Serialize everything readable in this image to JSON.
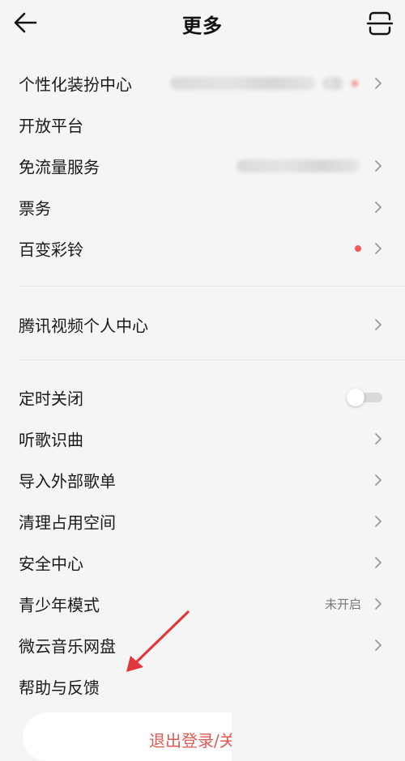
{
  "header": {
    "title": "更多",
    "back_icon": "arrow-left-icon",
    "scan_icon": "scan-icon"
  },
  "section1": [
    {
      "label": "个性化装扮中心"
    },
    {
      "label": "开放平台"
    },
    {
      "label": "免流量服务"
    },
    {
      "label": "票务"
    },
    {
      "label": "百变彩铃"
    }
  ],
  "section2": [
    {
      "label": "腾讯视频个人中心"
    }
  ],
  "section3": [
    {
      "label": "定时关闭",
      "toggle_on": false
    },
    {
      "label": "听歌识曲"
    },
    {
      "label": "导入外部歌单"
    },
    {
      "label": "清理占用空间"
    },
    {
      "label": "安全中心"
    },
    {
      "label": "青少年模式",
      "status": "未开启"
    },
    {
      "label": "微云音乐网盘"
    },
    {
      "label": "帮助与反馈"
    }
  ],
  "logout": {
    "label": "退出登录/关"
  },
  "colors": {
    "background": "#f5f5f5",
    "accent_red": "#e05a55",
    "dot_red": "#f05b5b"
  }
}
